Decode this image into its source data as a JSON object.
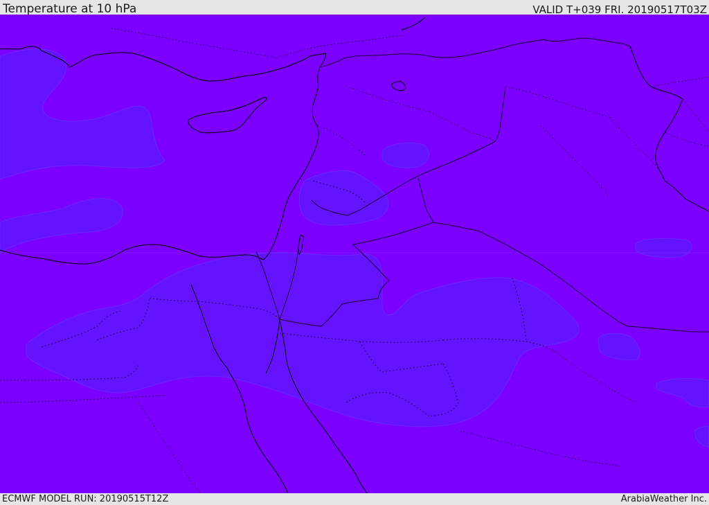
{
  "header": {
    "title": "Temperature at 10 hPa",
    "valid": "VALID T+039 FRI. 20190517T03Z"
  },
  "footer": {
    "model_run": "ECMWF MODEL RUN: 20190515T12Z",
    "credit": "ArabiaWeather Inc."
  },
  "map": {
    "colors": {
      "base_fill": "#7b00ff",
      "band_fill": "#6415ff",
      "coastline": "#000000",
      "borders": "#3a0066"
    }
  }
}
